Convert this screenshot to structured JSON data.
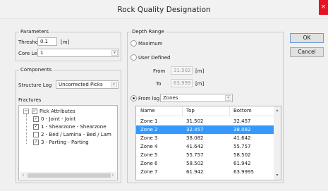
{
  "window": {
    "title": "Rock Quality Designation",
    "close_glyph": "×"
  },
  "parameters": {
    "group_label": "Parameters",
    "threshold_label": "Threshold",
    "threshold_value": "0.1",
    "threshold_unit": "[m]",
    "core_length_label": "Core Length",
    "core_length_value": "1"
  },
  "components": {
    "group_label": "Components",
    "structure_log_label": "Structure Log",
    "structure_log_value": "Uncorrected Picks",
    "fractures_label": "Fractures",
    "tree": {
      "root_label": "Pick Attributes",
      "items": [
        {
          "label": "0 - Joint - Joint",
          "checked": true
        },
        {
          "label": "1 - Shearzone - Shearzone",
          "checked": true
        },
        {
          "label": "2 - Bed / Lamina - Bed / Lam",
          "checked": false
        },
        {
          "label": "3 - Parting - Parting",
          "checked": true
        }
      ]
    }
  },
  "depth_range": {
    "group_label": "Depth Range",
    "maximum_label": "Maximum",
    "user_defined_label": "User Defined",
    "from_label": "From",
    "from_value": "31.502",
    "to_label": "To",
    "to_value": "63.999",
    "unit": "[m]",
    "from_log_label": "From log",
    "from_log_value": "Zones",
    "selected_option": "From log"
  },
  "zones_table": {
    "columns": [
      "Name",
      "Top",
      "Bottom"
    ],
    "rows": [
      [
        "Zone 1",
        "31.502",
        "32.457"
      ],
      [
        "Zone 2",
        "32.457",
        "38.082"
      ],
      [
        "Zone 3",
        "38.082",
        "41.642"
      ],
      [
        "Zone 4",
        "41.642",
        "55.757"
      ],
      [
        "Zone 5",
        "55.757",
        "58.502"
      ],
      [
        "Zone 6",
        "58.502",
        "61.942"
      ],
      [
        "Zone 7",
        "61.942",
        "63.9995"
      ]
    ],
    "selected_row": "Zone 2"
  },
  "buttons": {
    "ok": "OK",
    "cancel": "Cancel"
  },
  "icons": {
    "dropdown": "▾",
    "expander": "−",
    "check": "✓",
    "scroll_up": "▴",
    "scroll_down": "▾",
    "scroll_left": "‹",
    "scroll_right": "›"
  },
  "colors": {
    "selection": "#3399ff",
    "close": "#e81123",
    "default_button_border": "#6a9bd8"
  }
}
